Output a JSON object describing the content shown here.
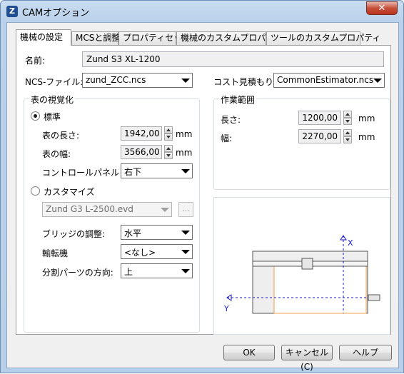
{
  "window": {
    "title": "CAMオプション",
    "close_glyph": "✕"
  },
  "tabs": [
    {
      "label": "機械の設定"
    },
    {
      "label": "MCSと調整"
    },
    {
      "label": "プロパティセット"
    },
    {
      "label": "機械のカスタムプロパティ"
    },
    {
      "label": "ツールのカスタムプロパティ"
    }
  ],
  "settings": {
    "name_label": "名前:",
    "name_value": "Zund S3 XL-1200",
    "ncs_label": "NCS-ファイル::",
    "ncs_value": "zund_ZCC.ncs",
    "cost_label": "コスト見積もりフ",
    "cost_value": "CommonEstimator.ncs"
  },
  "table_display": {
    "group_title": "表の視覚化",
    "standard_radio": "標準",
    "length_label": "表の長さ:",
    "length_value": "1942,00",
    "width_label": "表の幅:",
    "width_value": "3566,00",
    "unit": "mm",
    "control_panel_label": "コントロールパネル",
    "control_panel_value": "右下",
    "customize_radio": "カスタマイズ",
    "custom_file_value": "Zund G3 L-2500.evd",
    "browse_label": "...",
    "bridge_label": "ブリッジの調整:",
    "bridge_value": "水平",
    "conveyor_label": "輸転機",
    "conveyor_value": "<なし>",
    "split_label": "分割パーツの方向:",
    "split_value": "上"
  },
  "work_area": {
    "group_title": "作業範囲",
    "length_label": "長さ:",
    "length_value": "1200,00",
    "width_label": "幅:",
    "width_value": "2270,00",
    "unit": "mm"
  },
  "preview": {
    "x_axis": "X",
    "y_axis": "Y"
  },
  "buttons": {
    "ok": "OK",
    "cancel": "キャンセル(C)",
    "help": "ヘルプ"
  },
  "colors": {
    "axis": "#1a1acc",
    "work_area_outline": "#f0a050",
    "table_fill": "#eeeeee"
  }
}
